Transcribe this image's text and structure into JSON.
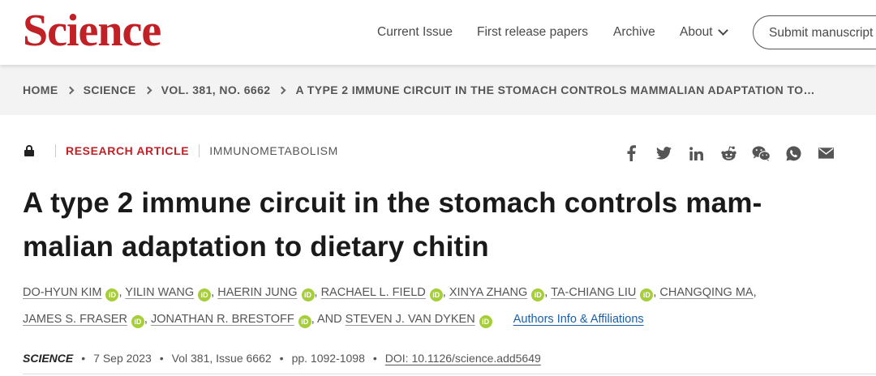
{
  "header": {
    "logo": "Science",
    "nav": {
      "current_issue": "Current Issue",
      "first_release": "First release papers",
      "archive": "Archive",
      "about": "About"
    },
    "submit": "Submit manuscript",
    "brand_color": "#c12126"
  },
  "breadcrumb": [
    "HOME",
    "SCIENCE",
    "VOL. 381, NO. 6662",
    "A TYPE 2 IMMUNE CIRCUIT IN THE STOMACH CONTROLS MAMMALIAN ADAPTATION TO…"
  ],
  "article": {
    "access_icon": "lock-icon",
    "type": "RESEARCH ARTICLE",
    "subject": "IMMUNOMETABOLISM",
    "title": "A type 2 immune circuit in the stomach controls mam-malian adaptation to dietary chitin",
    "share_icons": [
      "facebook-icon",
      "twitter-icon",
      "linkedin-icon",
      "reddit-icon",
      "wechat-icon",
      "whatsapp-icon",
      "email-icon"
    ],
    "authors": [
      "DO-HYUN KIM",
      "YILIN WANG",
      "HAERIN JUNG",
      "RACHAEL L. FIELD",
      "XINYA ZHANG",
      "TA-CHIANG LIU",
      "CHANGQING MA",
      "JAMES S. FRASER",
      "JONATHAN R. BRESTOFF",
      "STEVEN J. VAN DYKEN"
    ],
    "and_text": ", AND",
    "orcid_label": "iD",
    "affiliations_link": "Authors Info & Affiliations",
    "citation": {
      "journal": "SCIENCE",
      "date": "7 Sep 2023",
      "volume": "Vol 381, Issue 6662",
      "pages": "pp. 1092-1098",
      "doi": "DOI: 10.1126/science.add5649"
    }
  }
}
